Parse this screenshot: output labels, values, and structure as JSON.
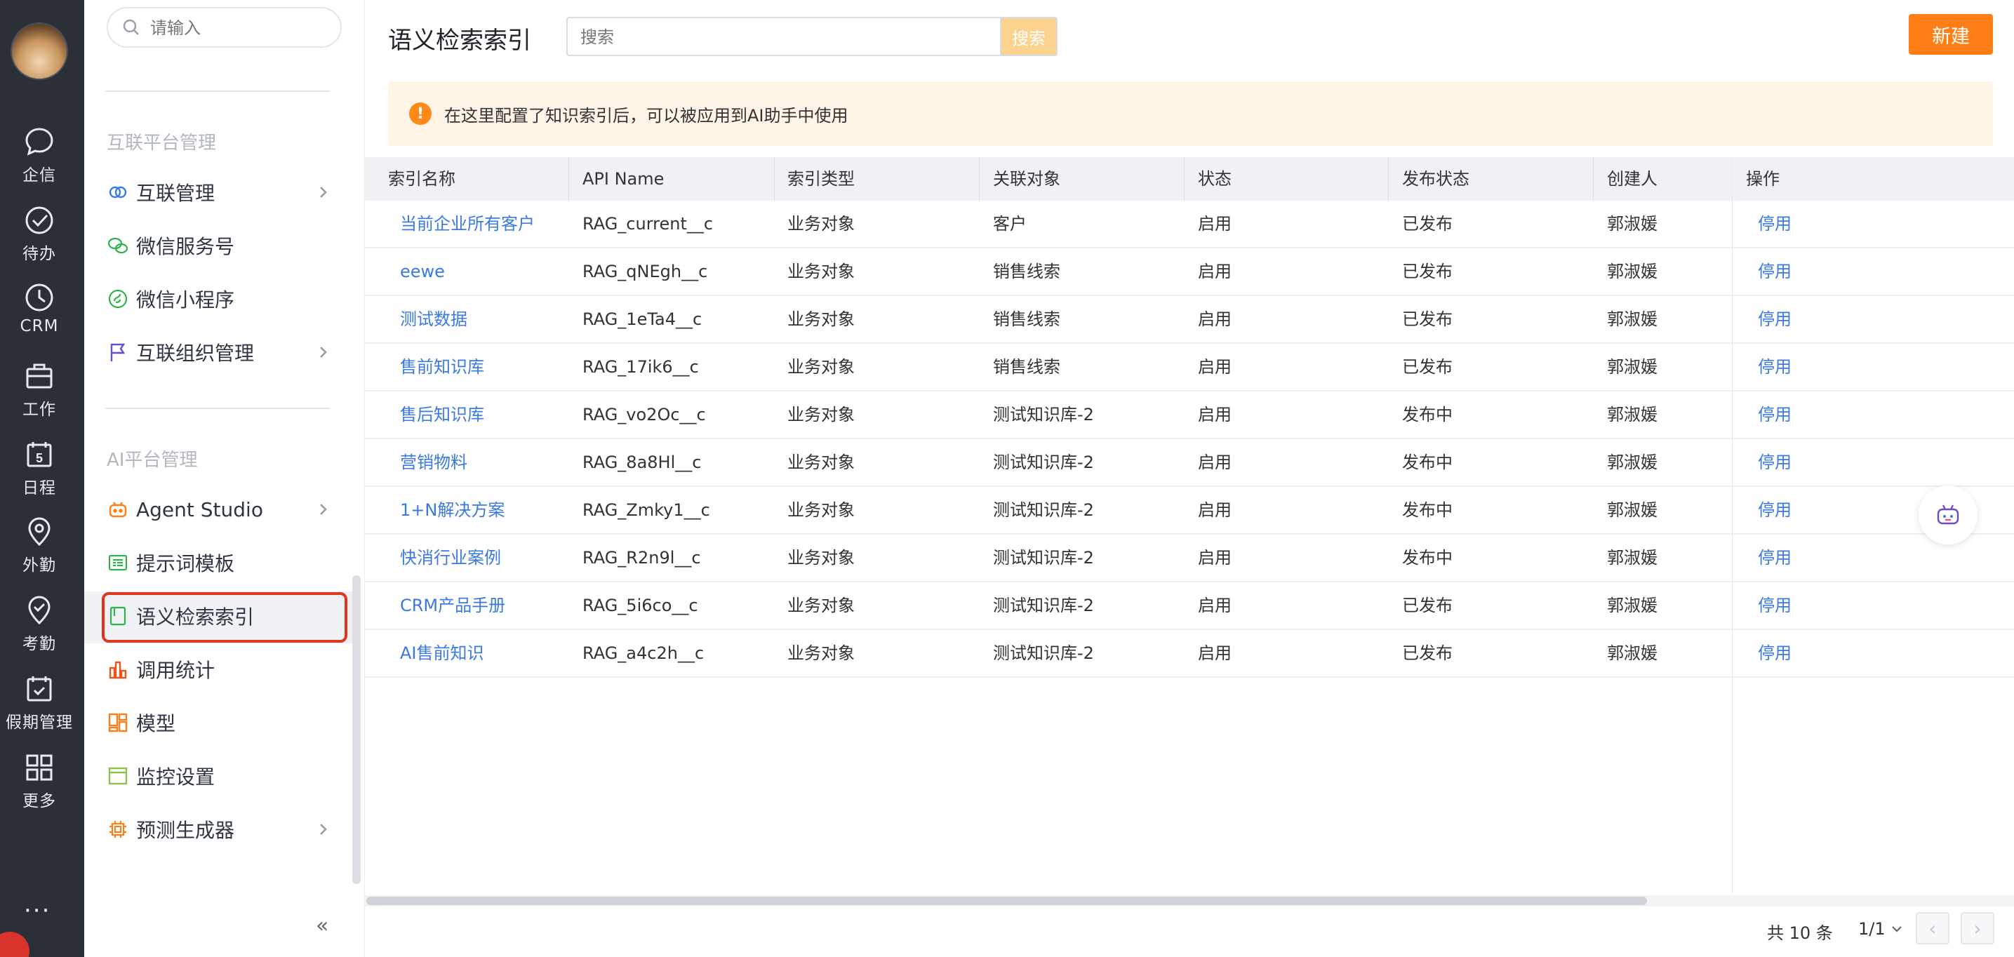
{
  "rail": {
    "items": [
      {
        "label": "企信",
        "icon": "chat-bubble-icon"
      },
      {
        "label": "待办",
        "icon": "check-circle-icon"
      },
      {
        "label": "CRM",
        "icon": "clock-icon"
      },
      {
        "label": "工作",
        "icon": "briefcase-icon"
      },
      {
        "label": "日程",
        "icon": "calendar-icon",
        "day": "5"
      },
      {
        "label": "外勤",
        "icon": "location-pin-icon"
      },
      {
        "label": "考勤",
        "icon": "check-badge-icon"
      },
      {
        "label": "假期管理",
        "icon": "calendar-check-icon"
      },
      {
        "label": "更多",
        "icon": "grid-icon"
      }
    ],
    "more_dots": "···"
  },
  "sidebar": {
    "search_placeholder": "请输入",
    "group1_title": "互联平台管理",
    "group1_items": [
      {
        "label": "互联管理",
        "icon": "link-circles-icon",
        "has_children": true
      },
      {
        "label": "微信服务号",
        "icon": "wechat-icon",
        "has_children": false
      },
      {
        "label": "微信小程序",
        "icon": "mini-program-icon",
        "has_children": false
      },
      {
        "label": "互联组织管理",
        "icon": "flag-icon",
        "has_children": true
      }
    ],
    "group2_title": "AI平台管理",
    "group2_items": [
      {
        "label": "Agent Studio",
        "icon": "robot-icon",
        "has_children": true
      },
      {
        "label": "提示词模板",
        "icon": "template-icon",
        "has_children": false
      },
      {
        "label": "语义检索索引",
        "icon": "document-icon",
        "has_children": false,
        "active": true
      },
      {
        "label": "调用统计",
        "icon": "bar-stats-icon",
        "has_children": false
      },
      {
        "label": "模型",
        "icon": "model-blocks-icon",
        "has_children": false
      },
      {
        "label": "监控设置",
        "icon": "monitor-icon",
        "has_children": false
      },
      {
        "label": "预测生成器",
        "icon": "chip-icon",
        "has_children": true
      }
    ],
    "collapse_glyph": "«"
  },
  "main": {
    "title": "语义检索索引",
    "search_placeholder": "搜索",
    "search_button": "搜索",
    "new_button": "新建",
    "notice": "在这里配置了知识索引后，可以被应用到AI助手中使用",
    "columns": [
      "索引名称",
      "API Name",
      "索引类型",
      "关联对象",
      "状态",
      "发布状态",
      "创建人",
      "操作"
    ],
    "rows": [
      {
        "name": "当前企业所有客户",
        "api": "RAG_current__c",
        "type": "业务对象",
        "object": "客户",
        "status": "启用",
        "publish": "已发布",
        "creator": "郭淑媛",
        "action": "停用"
      },
      {
        "name": "eewe",
        "api": "RAG_qNEgh__c",
        "type": "业务对象",
        "object": "销售线索",
        "status": "启用",
        "publish": "已发布",
        "creator": "郭淑媛",
        "action": "停用"
      },
      {
        "name": "测试数据",
        "api": "RAG_1eTa4__c",
        "type": "业务对象",
        "object": "销售线索",
        "status": "启用",
        "publish": "已发布",
        "creator": "郭淑媛",
        "action": "停用"
      },
      {
        "name": "售前知识库",
        "api": "RAG_17ik6__c",
        "type": "业务对象",
        "object": "销售线索",
        "status": "启用",
        "publish": "已发布",
        "creator": "郭淑媛",
        "action": "停用"
      },
      {
        "name": "售后知识库",
        "api": "RAG_vo2Oc__c",
        "type": "业务对象",
        "object": "测试知识库-2",
        "status": "启用",
        "publish": "发布中",
        "creator": "郭淑媛",
        "action": "停用"
      },
      {
        "name": "营销物料",
        "api": "RAG_8a8Hl__c",
        "type": "业务对象",
        "object": "测试知识库-2",
        "status": "启用",
        "publish": "发布中",
        "creator": "郭淑媛",
        "action": "停用"
      },
      {
        "name": "1+N解决方案",
        "api": "RAG_Zmky1__c",
        "type": "业务对象",
        "object": "测试知识库-2",
        "status": "启用",
        "publish": "发布中",
        "creator": "郭淑媛",
        "action": "停用"
      },
      {
        "name": "快消行业案例",
        "api": "RAG_R2n9l__c",
        "type": "业务对象",
        "object": "测试知识库-2",
        "status": "启用",
        "publish": "发布中",
        "creator": "郭淑媛",
        "action": "停用"
      },
      {
        "name": "CRM产品手册",
        "api": "RAG_5i6co__c",
        "type": "业务对象",
        "object": "测试知识库-2",
        "status": "启用",
        "publish": "已发布",
        "creator": "郭淑媛",
        "action": "停用"
      },
      {
        "name": "AI售前知识",
        "api": "RAG_a4c2h__c",
        "type": "业务对象",
        "object": "测试知识库-2",
        "status": "启用",
        "publish": "已发布",
        "creator": "郭淑媛",
        "action": "停用"
      }
    ],
    "pager": {
      "total": "共 10 条",
      "page": "1/1",
      "prev": "‹",
      "next": "›"
    },
    "colors": {
      "accent": "#ff7f16",
      "link": "#3a7ae0",
      "notice_bg": "#fff4e6",
      "rail_bg": "#2b2f38",
      "highlight": "#e0361e"
    }
  }
}
